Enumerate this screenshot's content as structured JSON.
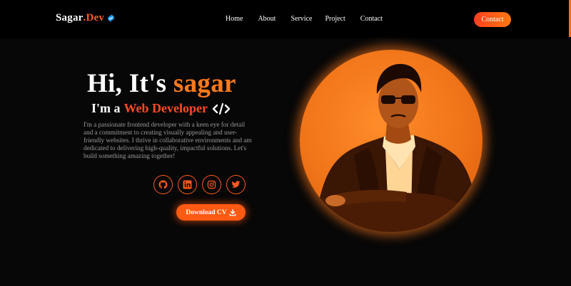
{
  "nav": {
    "logo_main": "Sagar",
    "logo_accent": ".Dev",
    "links": [
      "Home",
      "About",
      "Service",
      "Project",
      "Contact"
    ],
    "cta_label": "Contact"
  },
  "hero": {
    "greeting": "Hi, It's ",
    "name": "sagar",
    "role_prefix": "I'm a",
    "role_highlight": "Web Developer",
    "description": "I'm a passionate frontend developer with a keen eye for detail and a commitment to creating visually appealing and user-friendly websites. I thrive in collaborative environments and am dedicated to delivering high-quality, impactful solutions. Let's build something amazing together!",
    "social_icons": [
      "github-icon",
      "linkedin-icon",
      "instagram-icon",
      "twitter-icon"
    ],
    "download_label": "Download CV"
  },
  "colors": {
    "accent": "#ff5a1f",
    "background": "#070707",
    "name_orange": "#ff7a1c",
    "highlight_red": "#ff4a24",
    "verified_blue": "#1d9bf0"
  }
}
